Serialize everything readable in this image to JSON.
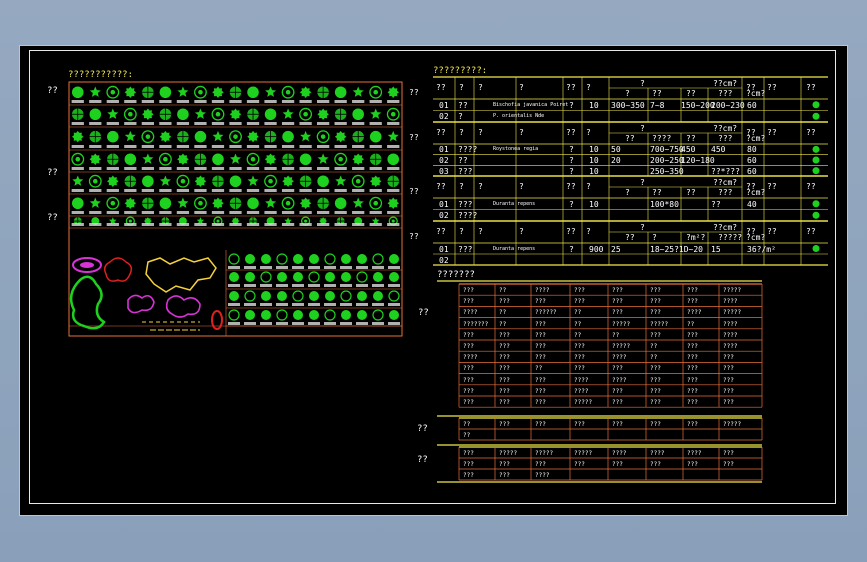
{
  "legend_title": "???????????:",
  "legend_side_labels": [
    "??",
    "??",
    "??",
    "??"
  ],
  "table1_title": "?????????:",
  "groups": [
    {
      "side": "??",
      "header_row1": [
        "??",
        "?",
        "?",
        "?",
        "??",
        "?",
        "?",
        "??cm?",
        "??",
        "??",
        "??"
      ],
      "header_row2": [
        "?",
        "??",
        "??",
        "???",
        "?cm?"
      ],
      "rows": [
        {
          "no": "01",
          "name": "??",
          "latin": "Bischofia javanica Poiret",
          "a": "?",
          "qty": "10",
          "h": "300~350",
          "d": "7~8",
          "w": "150~200",
          "c": "200~230",
          "e": "60"
        },
        {
          "no": "02",
          "name": "?",
          "latin": "P. orientalis Nde",
          "a": "",
          "qty": "",
          "h": "",
          "d": "",
          "w": "",
          "c": "",
          "e": ""
        }
      ]
    },
    {
      "side": "??",
      "header_row1": [
        "??",
        "?",
        "?",
        "?",
        "??",
        "?",
        "?",
        "??cm?",
        "??",
        "??",
        "??"
      ],
      "header_row2": [
        "??",
        "????",
        "??",
        "???",
        "?cm?"
      ],
      "rows": [
        {
          "no": "01",
          "name": "????",
          "latin": "Roystonea regia",
          "a": "?",
          "qty": "10",
          "h": "50",
          "d": "700~750",
          "w": "450",
          "c": "450",
          "e": "80"
        },
        {
          "no": "02",
          "name": "??",
          "latin": "",
          "a": "?",
          "qty": "10",
          "h": "20",
          "d": "200~250",
          "w": "120~180",
          "c": "",
          "e": "60"
        },
        {
          "no": "03",
          "name": "???",
          "latin": "",
          "a": "?",
          "qty": "10",
          "h": "",
          "d": "250~350",
          "w": "",
          "c": "??*???",
          "e": "60"
        }
      ]
    },
    {
      "side": "??",
      "header_row1": [
        "??",
        "?",
        "?",
        "?",
        "??",
        "?",
        "?",
        "??cm?",
        "??",
        "??",
        "??"
      ],
      "header_row2": [
        "?",
        "??",
        "??",
        "???",
        "?cm?"
      ],
      "rows": [
        {
          "no": "01",
          "name": "???",
          "latin": "Duranta repens",
          "a": "?",
          "qty": "10",
          "h": "",
          "d": "100*80",
          "w": "",
          "c": "??",
          "e": "40"
        },
        {
          "no": "02",
          "name": "????",
          "latin": "",
          "a": "",
          "qty": "",
          "h": "",
          "d": "",
          "w": "",
          "c": "",
          "e": ""
        }
      ]
    },
    {
      "side": "??",
      "header_row1": [
        "??",
        "?",
        "?",
        "?",
        "??",
        "?",
        "?",
        "??cm?",
        "??",
        "??",
        "??"
      ],
      "header_row2": [
        "??",
        "?",
        "?m²?",
        "?????",
        "?cm?"
      ],
      "rows": [
        {
          "no": "01",
          "name": "???",
          "latin": "Duranta repens",
          "a": "?",
          "qty": "900",
          "h": "25",
          "d": "18~25?1D~20",
          "w": "",
          "c": "15",
          "e": "36?/m²"
        },
        {
          "no": "02",
          "name": "",
          "latin": "",
          "a": "",
          "qty": "",
          "h": "",
          "d": "",
          "w": "",
          "c": "",
          "e": ""
        }
      ]
    }
  ],
  "table2_title": "???????",
  "table2_side_labels": [
    "??",
    "??",
    "??"
  ],
  "table2_rows": [
    [
      "???",
      "??",
      "????",
      "???",
      "???",
      "???",
      "???",
      "?????"
    ],
    [
      "???",
      "???",
      "???",
      "???",
      "???",
      "???",
      "???",
      "????"
    ],
    [
      "????",
      "??",
      "??????",
      "??",
      "???",
      "???",
      "????",
      "?????"
    ],
    [
      "???????",
      "??",
      "???",
      "??",
      "?????",
      "?????",
      "??",
      "????"
    ],
    [
      "???",
      "???",
      "???",
      "??",
      "??",
      "???",
      "???",
      "????"
    ],
    [
      "???",
      "???",
      "???",
      "???",
      "?????",
      "??",
      "???",
      "????"
    ],
    [
      "????",
      "???",
      "???",
      "???",
      "????",
      "??",
      "???",
      "???"
    ],
    [
      "???",
      "???",
      "??",
      "???",
      "???",
      "???",
      "???",
      "???"
    ],
    [
      "???",
      "???",
      "???",
      "????",
      "????",
      "???",
      "???",
      "???"
    ],
    [
      "???",
      "???",
      "???",
      "????",
      "???",
      "???",
      "???",
      "???"
    ],
    [
      "???",
      "???",
      "???",
      "?????",
      "???",
      "???",
      "???",
      "???"
    ]
  ],
  "table2b_rows": [
    [
      "??",
      "???",
      "???",
      "???",
      "???",
      "???",
      "???",
      "?????"
    ],
    [
      "??",
      "",
      "",
      "",
      "",
      "",
      "",
      ""
    ]
  ],
  "table2c_rows": [
    [
      "???",
      "?????",
      "?????",
      "?????",
      "????",
      "????",
      "????",
      "???"
    ],
    [
      "???",
      "???",
      "???",
      "???",
      "???",
      "???",
      "???",
      "???"
    ],
    [
      "???",
      "???",
      "????",
      "",
      "",
      "",
      "",
      ""
    ]
  ],
  "colors": {
    "background": "#000000",
    "grid": "#e8703a",
    "table_yellow": "#f2e94a",
    "symbol_green": "#1fd11f",
    "symbol_magenta": "#d733d7",
    "symbol_red": "#e02020",
    "text": "#ffffff"
  }
}
